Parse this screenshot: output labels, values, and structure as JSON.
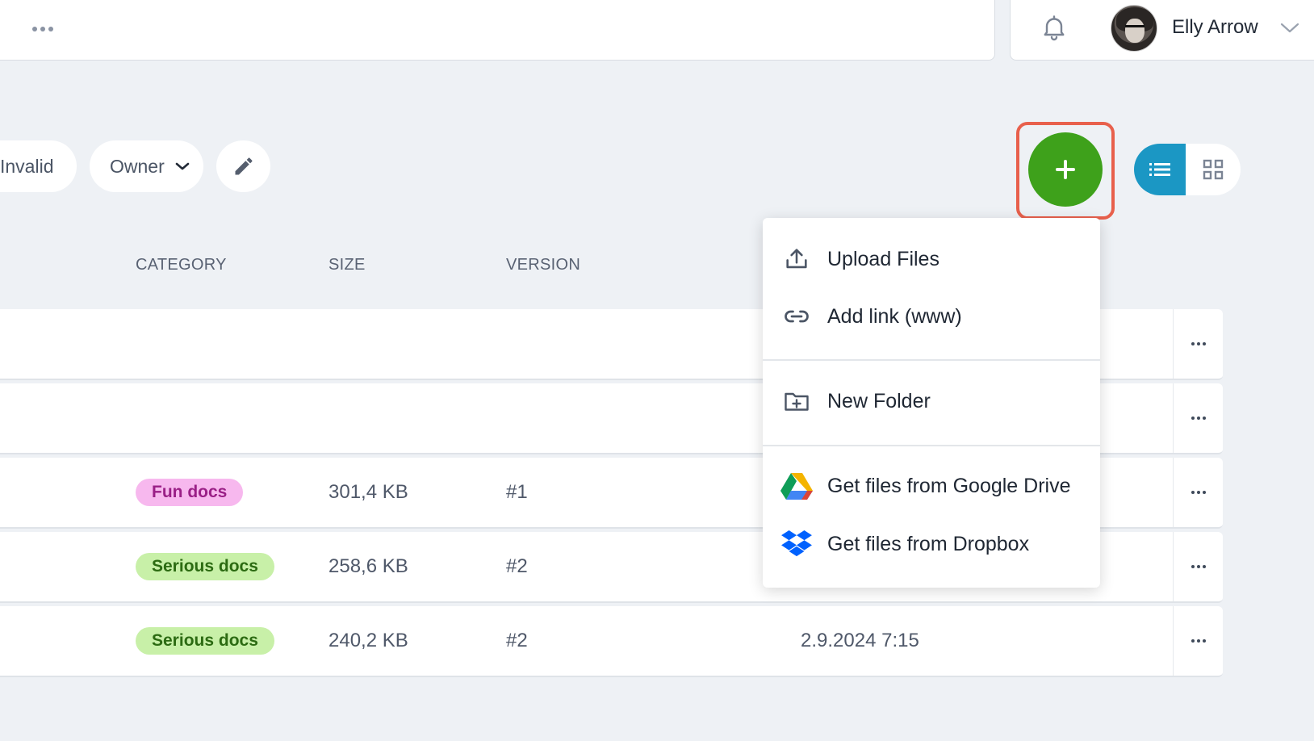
{
  "header": {
    "user_name": "Elly Arrow"
  },
  "filters": {
    "invalid_label": "Invalid",
    "owner_label": "Owner"
  },
  "table": {
    "columns": [
      "CATEGORY",
      "SIZE",
      "VERSION"
    ],
    "rows": [
      {
        "category": "",
        "size": "",
        "version": "",
        "date": ""
      },
      {
        "category": "",
        "size": "",
        "version": "",
        "date": ""
      },
      {
        "category": "Fun docs",
        "size": "301,4 KB",
        "version": "#1",
        "date": ""
      },
      {
        "category": "Serious docs",
        "size": "258,6 KB",
        "version": "#2",
        "date": ""
      },
      {
        "category": "Serious docs",
        "size": "240,2 KB",
        "version": "#2",
        "date": "2.9.2024 7:15"
      }
    ]
  },
  "add_menu": {
    "items": [
      {
        "label": "Upload Files",
        "icon": "upload-icon"
      },
      {
        "label": "Add link (www)",
        "icon": "link-icon"
      },
      {
        "label": "New Folder",
        "icon": "new-folder-icon"
      },
      {
        "label": "Get files from Google Drive",
        "icon": "google-drive-icon"
      },
      {
        "label": "Get files from Dropbox",
        "icon": "dropbox-icon"
      }
    ]
  },
  "colors": {
    "accent_green": "#3ea11b",
    "accent_blue": "#1b97c4",
    "highlight": "#e8604c",
    "fun_badge_bg": "#f7b8ee",
    "fun_badge_text": "#9a1f86",
    "serious_badge_bg": "#c8f0a8",
    "serious_badge_text": "#2c6b12"
  }
}
